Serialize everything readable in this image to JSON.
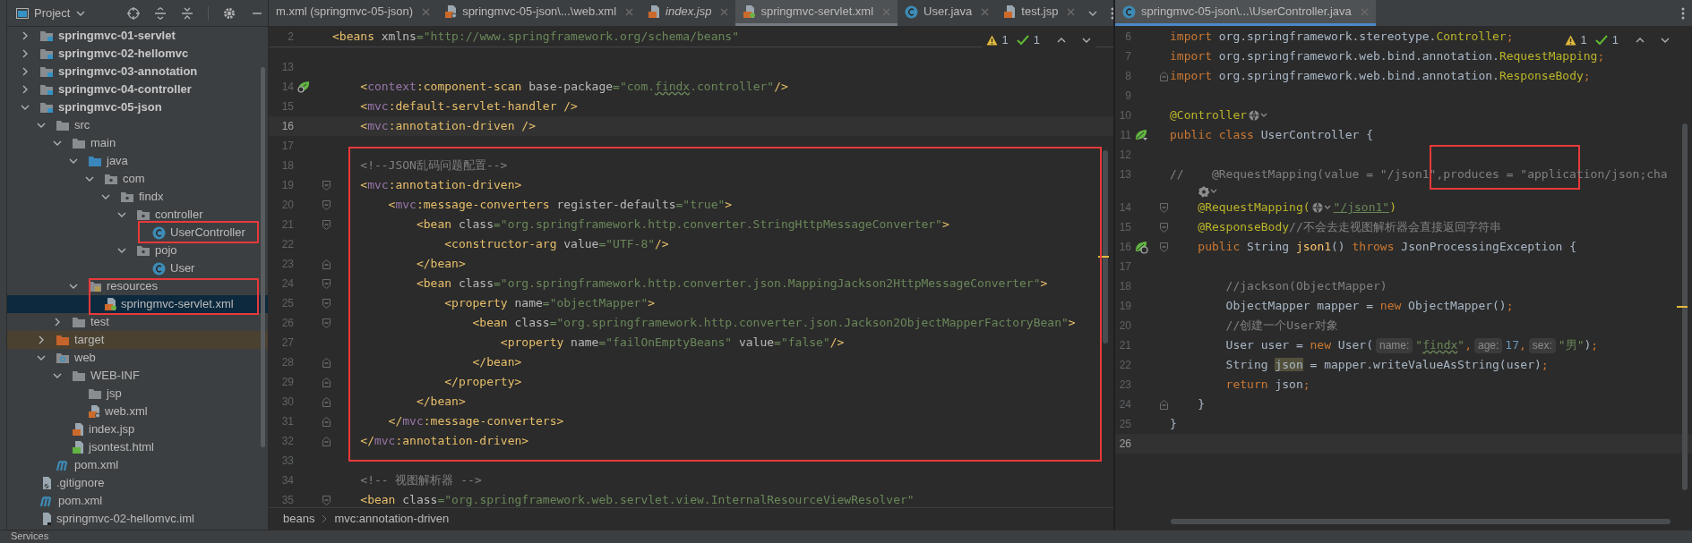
{
  "sidebar": {
    "title": "Project",
    "tree": [
      {
        "label": "springmvc-01-servlet",
        "kind": "module",
        "expanded": false,
        "selected": false
      },
      {
        "label": "springmvc-02-hellomvc",
        "kind": "module",
        "expanded": false,
        "selected": false
      },
      {
        "label": "springmvc-03-annotation",
        "kind": "module",
        "expanded": false,
        "selected": false
      },
      {
        "label": "springmvc-04-controller",
        "kind": "module",
        "expanded": false,
        "selected": false
      },
      {
        "label": "springmvc-05-json",
        "kind": "module",
        "expanded": true,
        "selected": false,
        "children": [
          {
            "label": "src",
            "kind": "folder",
            "expanded": true,
            "selected": false,
            "children": [
              {
                "label": "main",
                "kind": "folder",
                "expanded": true,
                "selected": false,
                "children": [
                  {
                    "label": "java",
                    "kind": "source-root",
                    "expanded": true,
                    "selected": false,
                    "children": [
                      {
                        "label": "com",
                        "kind": "package",
                        "expanded": true,
                        "selected": false,
                        "children": [
                          {
                            "label": "findx",
                            "kind": "package",
                            "expanded": true,
                            "selected": false,
                            "children": [
                              {
                                "label": "controller",
                                "kind": "package",
                                "expanded": true,
                                "selected": false,
                                "children": [
                                  {
                                    "label": "UserController",
                                    "kind": "class",
                                    "selected": false
                                  }
                                ]
                              },
                              {
                                "label": "pojo",
                                "kind": "package",
                                "expanded": true,
                                "selected": false,
                                "children": [
                                  {
                                    "label": "User",
                                    "kind": "class",
                                    "selected": false
                                  }
                                ]
                              }
                            ]
                          }
                        ]
                      }
                    ]
                  },
                  {
                    "label": "resources",
                    "kind": "resources",
                    "expanded": true,
                    "selected": false,
                    "children": [
                      {
                        "label": "springmvc-servlet.xml",
                        "kind": "spring-xml",
                        "selected": true
                      }
                    ]
                  }
                ]
              },
              {
                "label": "test",
                "kind": "folder",
                "expanded": false,
                "selected": false
              }
            ]
          },
          {
            "label": "target",
            "kind": "excluded",
            "expanded": false,
            "selected": false
          },
          {
            "label": "web",
            "kind": "web",
            "expanded": true,
            "selected": false,
            "children": [
              {
                "label": "WEB-INF",
                "kind": "folder",
                "expanded": true,
                "selected": false,
                "children": [
                  {
                    "label": "jsp",
                    "kind": "folder",
                    "selected": false
                  },
                  {
                    "label": "web.xml",
                    "kind": "xml",
                    "selected": false
                  }
                ]
              },
              {
                "label": "index.jsp",
                "kind": "jsp",
                "selected": false
              },
              {
                "label": "jsontest.html",
                "kind": "html",
                "selected": false
              }
            ]
          },
          {
            "label": "pom.xml",
            "kind": "maven",
            "selected": false
          }
        ]
      },
      {
        "label": ".gitignore",
        "kind": "ignore",
        "selected": false
      },
      {
        "label": "pom.xml",
        "kind": "maven",
        "selected": false
      },
      {
        "label": "springmvc-02-hellomvc.iml",
        "kind": "iml",
        "selected": false
      }
    ]
  },
  "editors": [
    {
      "tabs": [
        {
          "label": "m.xml (springmvc-05-json)",
          "kind": "none",
          "selected": false,
          "italic": false
        },
        {
          "label": "springmvc-05-json\\...\\web.xml",
          "kind": "xml",
          "selected": false,
          "italic": false
        },
        {
          "label": "index.jsp",
          "kind": "jsp",
          "selected": false,
          "italic": true
        },
        {
          "label": "springmvc-servlet.xml",
          "kind": "spring-xml",
          "selected": true,
          "italic": false
        },
        {
          "label": "User.java",
          "kind": "class",
          "selected": false,
          "italic": false
        },
        {
          "label": "test.jsp",
          "kind": "jsp",
          "selected": false,
          "italic": false
        }
      ],
      "inspections": {
        "warnings": "1",
        "passed": "1"
      },
      "sticky_line": {
        "number": "2",
        "tokens": [
          {
            "kind": "tag",
            "text": "<beans"
          },
          {
            "kind": "attr",
            "text": " xmlns"
          },
          {
            "kind": "str",
            "text": "=\"http://www.springframework.org/schema/beans\""
          }
        ]
      },
      "lines": [
        {
          "number": "13",
          "current": false
        },
        {
          "number": "14",
          "current": false,
          "gutter": {
            "kind": "leaf-search"
          },
          "tokens": [
            {
              "kind": "tag",
              "text": "    <"
            },
            {
              "kind": "ns",
              "text": "context"
            },
            {
              "kind": "tag",
              "text": ":component-scan"
            },
            {
              "kind": "attr",
              "text": " base-package"
            },
            {
              "kind": "str",
              "text": "=\"com."
            },
            {
              "kind": "typo",
              "text": "findx"
            },
            {
              "kind": "str",
              "text": ".controller\""
            },
            {
              "kind": "tag",
              "text": "/>"
            }
          ]
        },
        {
          "number": "15",
          "current": false,
          "tokens": [
            {
              "kind": "tag",
              "text": "    <"
            },
            {
              "kind": "ns",
              "text": "mvc"
            },
            {
              "kind": "tag",
              "text": ":default-servlet-handler />"
            }
          ]
        },
        {
          "number": "16",
          "current": true,
          "tokens": [
            {
              "kind": "tag",
              "text": "    <"
            },
            {
              "kind": "ns",
              "text": "mvc"
            },
            {
              "kind": "tag",
              "text": ":annotation-driven />"
            }
          ]
        },
        {
          "number": "17",
          "current": false
        },
        {
          "number": "18",
          "current": false,
          "tokens": [
            {
              "kind": "comment",
              "text": "    <!--JSON乱码问题配置-->"
            }
          ]
        },
        {
          "number": "19",
          "current": false,
          "fold": {
            "kind": "open"
          },
          "tokens": [
            {
              "kind": "tag",
              "text": "    <"
            },
            {
              "kind": "ns",
              "text": "mvc"
            },
            {
              "kind": "tag",
              "text": ":annotation-driven>"
            }
          ]
        },
        {
          "number": "20",
          "current": false,
          "fold": {
            "kind": "open"
          },
          "tokens": [
            {
              "kind": "tag",
              "text": "        <"
            },
            {
              "kind": "ns",
              "text": "mvc"
            },
            {
              "kind": "tag",
              "text": ":message-converters"
            },
            {
              "kind": "attr",
              "text": " register-defaults"
            },
            {
              "kind": "str",
              "text": "=\"true\""
            },
            {
              "kind": "tag",
              "text": ">"
            }
          ]
        },
        {
          "number": "21",
          "current": false,
          "fold": {
            "kind": "open"
          },
          "tokens": [
            {
              "kind": "tag",
              "text": "            <bean"
            },
            {
              "kind": "attr",
              "text": " class"
            },
            {
              "kind": "str",
              "text": "=\"org.springframework.http.converter.StringHttpMessageConverter\""
            },
            {
              "kind": "tag",
              "text": ">"
            }
          ]
        },
        {
          "number": "22",
          "current": false,
          "tokens": [
            {
              "kind": "tag",
              "text": "                <constructor-arg"
            },
            {
              "kind": "attr",
              "text": " value"
            },
            {
              "kind": "str",
              "text": "=\"UTF-8\""
            },
            {
              "kind": "tag",
              "text": "/>"
            }
          ]
        },
        {
          "number": "23",
          "current": false,
          "fold": {
            "kind": "close"
          },
          "tokens": [
            {
              "kind": "tag",
              "text": "            </bean>"
            }
          ]
        },
        {
          "number": "24",
          "current": false,
          "fold": {
            "kind": "open"
          },
          "tokens": [
            {
              "kind": "tag",
              "text": "            <bean"
            },
            {
              "kind": "attr",
              "text": " class"
            },
            {
              "kind": "str",
              "text": "=\"org.springframework.http.converter.json.MappingJackson2HttpMessageConverter\""
            },
            {
              "kind": "tag",
              "text": ">"
            }
          ]
        },
        {
          "number": "25",
          "current": false,
          "fold": {
            "kind": "open"
          },
          "tokens": [
            {
              "kind": "tag",
              "text": "                <property"
            },
            {
              "kind": "attr",
              "text": " name"
            },
            {
              "kind": "str",
              "text": "=\"objectMapper\""
            },
            {
              "kind": "tag",
              "text": ">"
            }
          ]
        },
        {
          "number": "26",
          "current": false,
          "fold": {
            "kind": "open"
          },
          "tokens": [
            {
              "kind": "tag",
              "text": "                    <bean"
            },
            {
              "kind": "attr",
              "text": " class"
            },
            {
              "kind": "str",
              "text": "=\"org.springframework.http.converter.json.Jackson2ObjectMapperFactoryBean\""
            },
            {
              "kind": "tag",
              "text": ">"
            }
          ]
        },
        {
          "number": "27",
          "current": false,
          "tokens": [
            {
              "kind": "tag",
              "text": "                        <property"
            },
            {
              "kind": "attr",
              "text": " name"
            },
            {
              "kind": "str",
              "text": "=\"failOnEmptyBeans\""
            },
            {
              "kind": "attr",
              "text": " value"
            },
            {
              "kind": "str",
              "text": "=\"false\""
            },
            {
              "kind": "tag",
              "text": "/>"
            }
          ]
        },
        {
          "number": "28",
          "current": false,
          "fold": {
            "kind": "close"
          },
          "tokens": [
            {
              "kind": "tag",
              "text": "                    </bean>"
            }
          ]
        },
        {
          "number": "29",
          "current": false,
          "fold": {
            "kind": "close"
          },
          "tokens": [
            {
              "kind": "tag",
              "text": "                </property>"
            }
          ]
        },
        {
          "number": "30",
          "current": false,
          "fold": {
            "kind": "close"
          },
          "tokens": [
            {
              "kind": "tag",
              "text": "            </bean>"
            }
          ]
        },
        {
          "number": "31",
          "current": false,
          "fold": {
            "kind": "close"
          },
          "tokens": [
            {
              "kind": "tag",
              "text": "        </"
            },
            {
              "kind": "ns",
              "text": "mvc"
            },
            {
              "kind": "tag",
              "text": ":message-converters>"
            }
          ]
        },
        {
          "number": "32",
          "current": false,
          "fold": {
            "kind": "close"
          },
          "tokens": [
            {
              "kind": "tag",
              "text": "    </"
            },
            {
              "kind": "ns",
              "text": "mvc"
            },
            {
              "kind": "tag",
              "text": ":annotation-driven>"
            }
          ]
        },
        {
          "number": "33",
          "current": false
        },
        {
          "number": "34",
          "current": false,
          "tokens": [
            {
              "kind": "comment",
              "text": "    <!-- 视图解析器 -->"
            }
          ]
        },
        {
          "number": "35",
          "current": false,
          "fold": {
            "kind": "open"
          },
          "tokens": [
            {
              "kind": "tag",
              "text": "    <bean"
            },
            {
              "kind": "attr",
              "text": " class"
            },
            {
              "kind": "str",
              "text": "=\"org.springframework.web.servlet.view.InternalResourceViewResolver\""
            }
          ]
        }
      ],
      "breadcrumbs": [
        "beans",
        "mvc:annotation-driven"
      ]
    },
    {
      "tabs": [
        {
          "label": "springmvc-05-json\\...\\UserController.java",
          "kind": "class",
          "selected": true,
          "italic": false
        }
      ],
      "inspections": {
        "warnings": "1",
        "passed": "1"
      },
      "lines": [
        {
          "number": "6",
          "current": false,
          "tokens": [
            {
              "kind": "kw",
              "text": "import"
            },
            {
              "kind": "plain",
              "text": " org.springframework.stereotype."
            },
            {
              "kind": "cls",
              "text": "Controller"
            },
            {
              "kind": "kw",
              "text": ";"
            }
          ]
        },
        {
          "number": "7",
          "current": false,
          "tokens": [
            {
              "kind": "kw",
              "text": "import"
            },
            {
              "kind": "plain",
              "text": " org.springframework.web.bind.annotation."
            },
            {
              "kind": "cls",
              "text": "RequestMapping"
            },
            {
              "kind": "kw",
              "text": ";"
            }
          ]
        },
        {
          "number": "8",
          "current": false,
          "fold": {
            "kind": "close"
          },
          "tokens": [
            {
              "kind": "kw",
              "text": "import"
            },
            {
              "kind": "plain",
              "text": " org.springframework.web.bind.annotation."
            },
            {
              "kind": "cls",
              "text": "ResponseBody"
            },
            {
              "kind": "kw",
              "text": ";"
            }
          ]
        },
        {
          "number": "9",
          "current": false
        },
        {
          "number": "10",
          "current": false,
          "tokens": [
            {
              "kind": "ann",
              "text": "@Controller"
            },
            {
              "kind": "globe"
            }
          ]
        },
        {
          "number": "11",
          "current": false,
          "gutter": {
            "kind": "leaf-down"
          },
          "tokens": [
            {
              "kind": "kw",
              "text": "public class"
            },
            {
              "kind": "plain",
              "text": " UserController {"
            }
          ]
        },
        {
          "number": "12",
          "current": false
        },
        {
          "number": "13",
          "current": false,
          "tokens": [
            {
              "kind": "comment",
              "text": "//    @RequestMapping(value = \"/json1\",produces = \"application/json;cha"
            }
          ]
        },
        {
          "tokens": [
            {
              "kind": "badge"
            }
          ]
        },
        {
          "number": "14",
          "current": false,
          "fold": {
            "kind": "open"
          },
          "tokens": [
            {
              "kind": "ann",
              "text": "    @RequestMapping("
            },
            {
              "kind": "globe"
            },
            {
              "kind": "link",
              "text": "\"/json1\""
            },
            {
              "kind": "ann",
              "text": ")"
            }
          ]
        },
        {
          "number": "15",
          "current": false,
          "fold": {
            "kind": "open"
          },
          "tokens": [
            {
              "kind": "ann",
              "text": "    @ResponseBody"
            },
            {
              "kind": "comment",
              "text": "//不会去走视图解析器会直接返回字符串"
            }
          ]
        },
        {
          "number": "16",
          "current": false,
          "gutter": {
            "kind": "leaf-globe"
          },
          "fold": {
            "kind": "open"
          },
          "tokens": [
            {
              "kind": "kw",
              "text": "    public"
            },
            {
              "kind": "plain",
              "text": " String "
            },
            {
              "kind": "method",
              "text": "json1"
            },
            {
              "kind": "plain",
              "text": "() "
            },
            {
              "kind": "kw",
              "text": "throws"
            },
            {
              "kind": "plain",
              "text": " JsonProcessingException {"
            }
          ]
        },
        {
          "number": "17",
          "current": false
        },
        {
          "number": "18",
          "current": false,
          "tokens": [
            {
              "kind": "comment",
              "text": "        //jackson(ObjectMapper)"
            }
          ]
        },
        {
          "number": "19",
          "current": false,
          "tokens": [
            {
              "kind": "plain",
              "text": "        ObjectMapper mapper = "
            },
            {
              "kind": "kw",
              "text": "new"
            },
            {
              "kind": "plain",
              "text": " ObjectMapper()"
            },
            {
              "kind": "kw",
              "text": ";"
            }
          ]
        },
        {
          "number": "20",
          "current": false,
          "tokens": [
            {
              "kind": "comment",
              "text": "        //创建一个User对象"
            }
          ]
        },
        {
          "number": "21",
          "current": false,
          "tokens": [
            {
              "kind": "plain",
              "text": "        User user = "
            },
            {
              "kind": "kw",
              "text": "new"
            },
            {
              "kind": "plain",
              "text": " User("
            },
            {
              "kind": "hint",
              "text": "name:"
            },
            {
              "kind": "str",
              "text": "\""
            },
            {
              "kind": "typo",
              "text": "findx"
            },
            {
              "kind": "str",
              "text": "\""
            },
            {
              "kind": "kw",
              "text": ","
            },
            {
              "kind": "hint",
              "text": "age:"
            },
            {
              "kind": "num",
              "text": "17"
            },
            {
              "kind": "kw",
              "text": ","
            },
            {
              "kind": "hint",
              "text": "sex:"
            },
            {
              "kind": "str",
              "text": "\"男\""
            },
            {
              "kind": "plain",
              "text": ")"
            },
            {
              "kind": "kw",
              "text": ";"
            }
          ]
        },
        {
          "number": "22",
          "current": false,
          "tokens": [
            {
              "kind": "plain",
              "text": "        String "
            },
            {
              "kind": "hl",
              "text": "json"
            },
            {
              "kind": "plain",
              "text": " = mapper.writeValueAsString(user)"
            },
            {
              "kind": "kw",
              "text": ";"
            }
          ]
        },
        {
          "number": "23",
          "current": false,
          "tokens": [
            {
              "kind": "kw",
              "text": "        return"
            },
            {
              "kind": "plain",
              "text": " json"
            },
            {
              "kind": "kw",
              "text": ";"
            }
          ]
        },
        {
          "number": "24",
          "current": false,
          "fold": {
            "kind": "close"
          },
          "tokens": [
            {
              "kind": "plain",
              "text": "    }"
            }
          ]
        },
        {
          "number": "25",
          "current": false,
          "tokens": [
            {
              "kind": "plain",
              "text": "}"
            }
          ]
        },
        {
          "number": "26",
          "current": true
        }
      ]
    }
  ],
  "bottom_bar": {
    "label": "Services"
  }
}
